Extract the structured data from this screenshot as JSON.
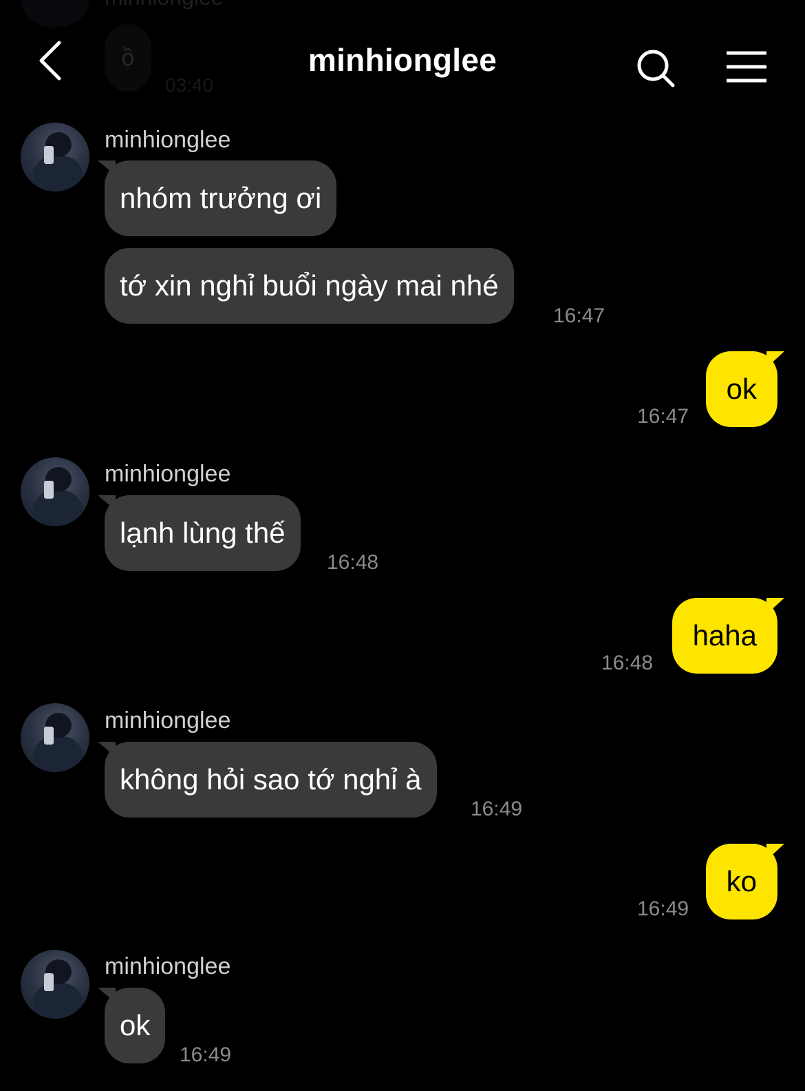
{
  "ghost": {
    "name": "minhionglee",
    "message": "ồ",
    "time": "03:40"
  },
  "header": {
    "title": "minhionglee",
    "back_icon": "chevron-left-icon",
    "search_icon": "search-icon",
    "menu_icon": "hamburger-menu-icon"
  },
  "messages": [
    {
      "sender": "minhionglee",
      "text": "nhóm trưởng ơi",
      "direction": "incoming"
    },
    {
      "text": "tớ xin nghỉ buổi ngày mai nhé",
      "time": "16:47",
      "direction": "incoming"
    },
    {
      "text": "ok",
      "time": "16:47",
      "direction": "outgoing"
    },
    {
      "sender": "minhionglee",
      "text": "lạnh lùng thế",
      "time": "16:48",
      "direction": "incoming"
    },
    {
      "text": "haha",
      "time": "16:48",
      "direction": "outgoing"
    },
    {
      "sender": "minhionglee",
      "text": "không hỏi sao tớ nghỉ à",
      "time": "16:49",
      "direction": "incoming"
    },
    {
      "text": "ko",
      "time": "16:49",
      "direction": "outgoing"
    },
    {
      "sender": "minhionglee",
      "text": "ok",
      "time": "16:49",
      "direction": "incoming"
    }
  ],
  "colors": {
    "background": "#000000",
    "incoming_bubble": "#3a3a3c",
    "outgoing_bubble": "#fee500",
    "time": "#8a8a8e"
  }
}
